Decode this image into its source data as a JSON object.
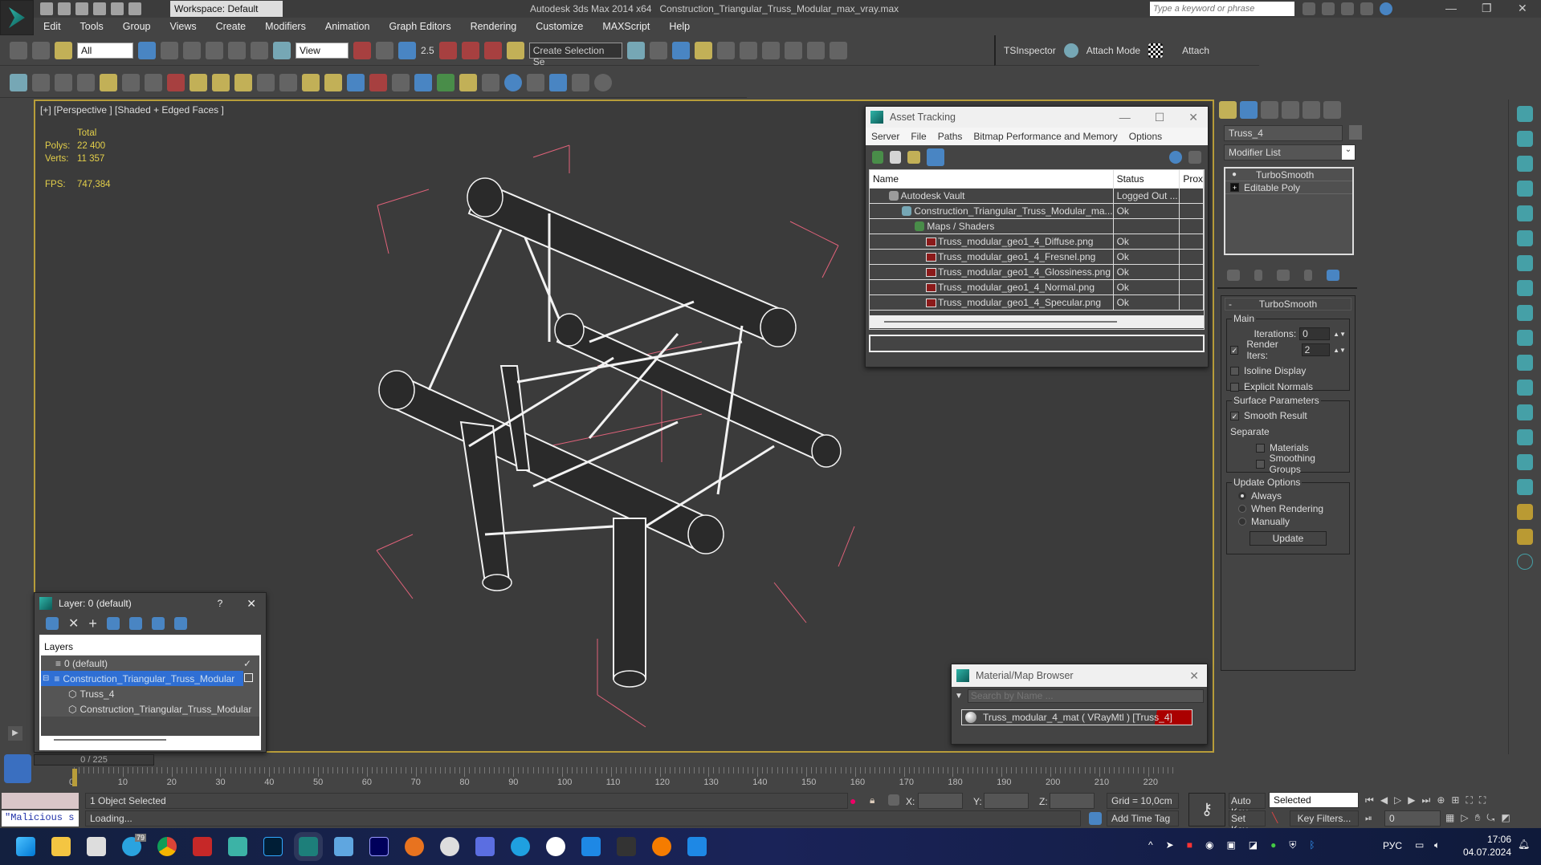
{
  "app": {
    "title": "Autodesk 3ds Max  2014 x64",
    "file": "Construction_Triangular_Truss_Modular_max_vray.max",
    "workspace": "Workspace: Default",
    "search_placeholder": "Type a keyword or phrase"
  },
  "menu": [
    "Edit",
    "Tools",
    "Group",
    "Views",
    "Create",
    "Modifiers",
    "Animation",
    "Graph Editors",
    "Rendering",
    "Customize",
    "MAXScript",
    "Help"
  ],
  "toolbar": {
    "filter": "All",
    "refcoord": "View",
    "snap_value": "2.5",
    "named_selection": "Create Selection Se",
    "tsinspector": "TSInspector",
    "attach_mode": "Attach Mode",
    "attach": "Attach"
  },
  "viewport": {
    "label": "[+] [Perspective ] [Shaded + Edged Faces ]",
    "stats_header": "Total",
    "polys_label": "Polys:",
    "polys": "22 400",
    "verts_label": "Verts:",
    "verts": "11 357",
    "fps_label": "FPS:",
    "fps": "747,384"
  },
  "asset_tracking": {
    "title": "Asset Tracking",
    "menu": [
      "Server",
      "File",
      "Paths",
      "Bitmap Performance and Memory",
      "Options"
    ],
    "columns": [
      "Name",
      "Status",
      "Prox"
    ],
    "rows": [
      {
        "name": "Autodesk Vault",
        "status": "Logged Out ...",
        "icon": "vault-icon"
      },
      {
        "name": "Construction_Triangular_Truss_Modular_ma...",
        "status": "Ok",
        "icon": "max-file-icon"
      },
      {
        "name": "Maps / Shaders",
        "status": "",
        "icon": "maps-icon"
      },
      {
        "name": "Truss_modular_geo1_4_Diffuse.png",
        "status": "Ok",
        "icon": "png-icon"
      },
      {
        "name": "Truss_modular_geo1_4_Fresnel.png",
        "status": "Ok",
        "icon": "png-icon"
      },
      {
        "name": "Truss_modular_geo1_4_Glossiness.png",
        "status": "Ok",
        "icon": "png-icon"
      },
      {
        "name": "Truss_modular_geo1_4_Normal.png",
        "status": "Ok",
        "icon": "png-icon"
      },
      {
        "name": "Truss_modular_geo1_4_Specular.png",
        "status": "Ok",
        "icon": "png-icon"
      }
    ]
  },
  "command_panel": {
    "object_name": "Truss_4",
    "modifier_list": "Modifier List",
    "stack": [
      "TurboSmooth",
      "Editable Poly"
    ],
    "rollout": "TurboSmooth",
    "main": "Main",
    "iterations_label": "Iterations:",
    "iterations": "0",
    "render_iters_label": "Render Iters:",
    "render_iters": "2",
    "isoline": "Isoline Display",
    "explicit_normals": "Explicit Normals",
    "surface": "Surface Parameters",
    "smooth_result": "Smooth Result",
    "separate": "Separate",
    "materials": "Materials",
    "smoothing_groups": "Smoothing Groups",
    "update_options": "Update Options",
    "always": "Always",
    "when_rendering": "When Rendering",
    "manually": "Manually",
    "update": "Update"
  },
  "layer_window": {
    "title": "Layer: 0 (default)",
    "help": "?",
    "header": "Layers",
    "items": [
      "0 (default)",
      "Construction_Triangular_Truss_Modular",
      "Truss_4",
      "Construction_Triangular_Truss_Modular"
    ]
  },
  "material_browser": {
    "title": "Material/Map Browser",
    "search_placeholder": "Search by Name ...",
    "item": "Truss_modular_4_mat  ( VRayMtl )  [Truss_4]"
  },
  "timeline": {
    "frame": "0 / 225",
    "ticks": [
      "0",
      "10",
      "20",
      "30",
      "40",
      "50",
      "60",
      "70",
      "80",
      "90",
      "100",
      "110",
      "120",
      "130",
      "140",
      "150",
      "160",
      "170",
      "180",
      "190",
      "200",
      "210",
      "220"
    ]
  },
  "status": {
    "selection": "1 Object Selected",
    "prompt": "Loading...",
    "script": "\"Malicious s",
    "x": "X:",
    "y": "Y:",
    "z": "Z:",
    "grid": "Grid = 10,0cm",
    "add_time_tag": "Add Time Tag",
    "auto_key": "Auto Key",
    "set_key": "Set Key",
    "key_mode": "Selected",
    "key_filters": "Key Filters...",
    "current_frame": "0"
  },
  "taskbar": {
    "lang": "РУС",
    "time": "17:06",
    "date": "04.07.2024",
    "telegram_badge": "79"
  }
}
